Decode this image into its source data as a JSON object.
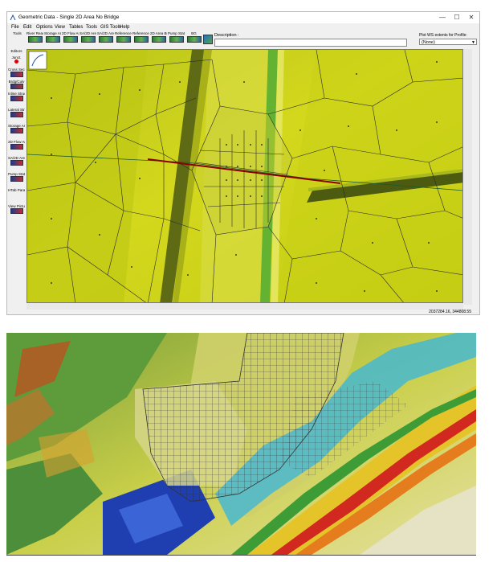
{
  "window": {
    "title": "Geometric Data - Single 2D Area No Bridge",
    "controls": {
      "minimize": "—",
      "maximize": "☐",
      "close": "✕"
    }
  },
  "menu": [
    "File",
    "Edit",
    "Options",
    "View",
    "Tables",
    "Tools",
    "GIS Tools",
    "Help"
  ],
  "toolbar": {
    "buttons": [
      "Tools",
      "River Reach",
      "Storage Area",
      "2D Flow Area",
      "SA/2D Area Conn",
      "SA/2D Area BC Lines",
      "Reference Lines",
      "Reference Points",
      "2D Area Break Lines",
      "Pump Station",
      "BG"
    ],
    "description_label": "Description :",
    "description_value": "",
    "plot_label": "Plot WS extents for Profile:",
    "plot_value": "(None)"
  },
  "left_panel": {
    "header": "Editors",
    "items": [
      "Junct.",
      "Cross Section",
      "Brdg/Culv",
      "Inline Structure",
      "Lateral Structure",
      "Storage Area",
      "2D Flow Area",
      "SA/2D Area Conn",
      "Pump Station",
      "HTab Param.",
      "View Picture"
    ]
  },
  "status": {
    "coords": "2037284.16, 344808.55"
  },
  "colors": {
    "terrain_base": "#c7cf15",
    "mesh_line": "#2b2b2b",
    "structure_line": "#8b0000"
  }
}
